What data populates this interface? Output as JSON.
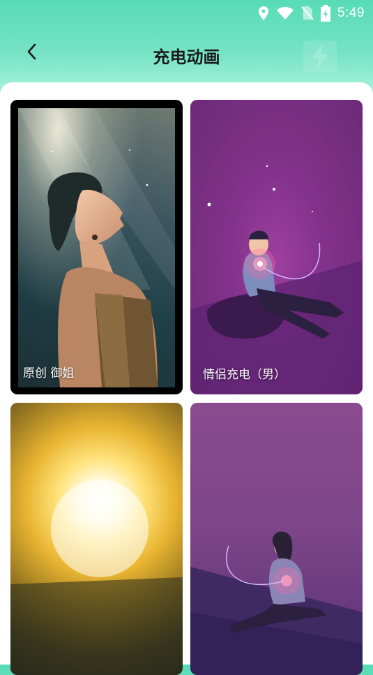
{
  "status_bar": {
    "time": "5:49",
    "icons": [
      "location-icon",
      "wifi-icon",
      "no-sim-icon",
      "battery-charging-icon"
    ]
  },
  "header": {
    "title": "充电动画",
    "back_icon": "chevron-left-icon"
  },
  "animations": [
    {
      "label": "原创 御姐"
    },
    {
      "label": "情侣充电（男）"
    },
    {
      "label": ""
    },
    {
      "label": ""
    }
  ],
  "colors": {
    "header_gradient_top": "#57dcb4",
    "title_text": "#1a1a1a",
    "label_text": "#ffffff"
  }
}
